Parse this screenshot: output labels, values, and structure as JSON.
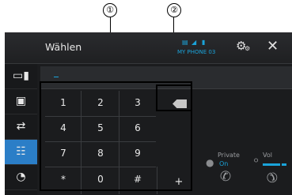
{
  "callouts": [
    "①",
    "②"
  ],
  "header": {
    "title": "Wählen",
    "device_name": "MY PHONE 03"
  },
  "rail": {
    "items": [
      {
        "icon": "phonebook-icon",
        "glyph": "▍▍"
      },
      {
        "icon": "contacts-icon",
        "glyph": "▣"
      },
      {
        "icon": "call-history-icon",
        "glyph": "⇄"
      },
      {
        "icon": "keypad-icon",
        "glyph": "☷",
        "active": true
      },
      {
        "icon": "voice-dial-icon",
        "glyph": "◔"
      }
    ]
  },
  "display": {
    "number": ""
  },
  "keypad": {
    "keys": [
      "1",
      "2",
      "3",
      "4",
      "5",
      "6",
      "7",
      "8",
      "9",
      "*",
      "0",
      "#"
    ],
    "plus": "+"
  },
  "controls": {
    "private_label": "Private",
    "private_value": "On",
    "volume_label": "Vol"
  },
  "colors": {
    "accent": "#1aa3d9",
    "background": "#1b1c1e",
    "active_tab": "#2b7ec7"
  }
}
